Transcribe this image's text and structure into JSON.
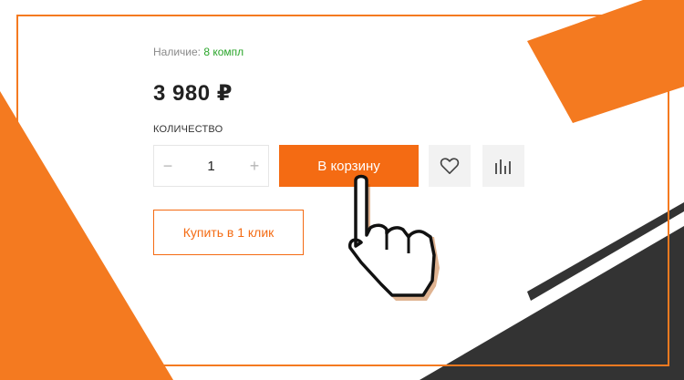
{
  "product": {
    "availability_label": "Наличие:",
    "availability_value": "8 компл",
    "price": "3 980 ₽",
    "quantity_title": "КОЛИЧЕСТВО",
    "quantity": {
      "minus": "−",
      "value": "1",
      "plus": "+"
    },
    "add_to_cart_label": "В корзину",
    "buy_one_click_label": "Купить в 1 клик"
  },
  "icons": {
    "favorite": "heart-icon",
    "compare": "compare-icon",
    "cursor": "hand-pointer-icon"
  },
  "colors": {
    "accent": "#f46b13",
    "decor_orange": "#f47a20",
    "decor_dark": "#333333",
    "availability_green": "#2aa52a"
  }
}
